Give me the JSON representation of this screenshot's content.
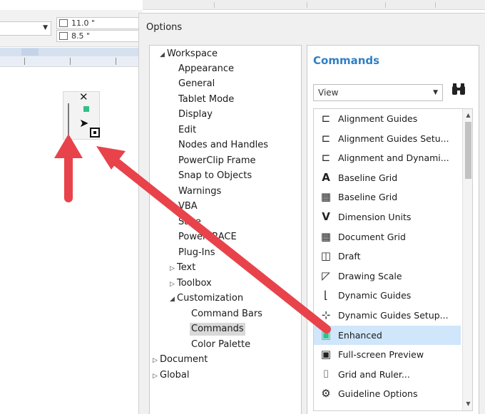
{
  "propbar": {
    "width_value": "11.0 \"",
    "height_value": "8.5 \""
  },
  "dialog": {
    "title": "Options"
  },
  "tree": {
    "items": [
      {
        "label": "Workspace",
        "expander": "◢"
      },
      {
        "label": "Appearance"
      },
      {
        "label": "General"
      },
      {
        "label": "Tablet Mode"
      },
      {
        "label": "Display"
      },
      {
        "label": "Edit"
      },
      {
        "label": "Nodes and Handles"
      },
      {
        "label": "PowerClip Frame"
      },
      {
        "label": "Snap to Objects"
      },
      {
        "label": "Warnings"
      },
      {
        "label": "VBA"
      },
      {
        "label": "Save"
      },
      {
        "label": "PowerTRACE"
      },
      {
        "label": "Plug-Ins"
      },
      {
        "label": "Text",
        "expander": "▷"
      },
      {
        "label": "Toolbox",
        "expander": "▷"
      },
      {
        "label": "Customization",
        "expander": "◢"
      },
      {
        "label": "Command Bars"
      },
      {
        "label": "Commands"
      },
      {
        "label": "Color Palette"
      },
      {
        "label": "Document",
        "expander": "▷"
      },
      {
        "label": "Global",
        "expander": "▷"
      }
    ]
  },
  "panel": {
    "title": "Commands",
    "category_select": "View"
  },
  "commands": [
    {
      "label": "Alignment Guides",
      "icon": "alignment-guides-icon",
      "glyph": "⊏"
    },
    {
      "label": "Alignment Guides Setu...",
      "icon": "alignment-guides-setup-icon",
      "glyph": "⊏"
    },
    {
      "label": "Alignment and Dynami...",
      "icon": "alignment-dynamic-icon",
      "glyph": "⊏"
    },
    {
      "label": "Baseline Grid",
      "icon": "baseline-grid-a-icon",
      "glyph": "A"
    },
    {
      "label": "Baseline Grid",
      "icon": "baseline-grid-icon",
      "glyph": "▦"
    },
    {
      "label": "Dimension Units",
      "icon": "dimension-units-icon",
      "glyph": "V"
    },
    {
      "label": "Document Grid",
      "icon": "document-grid-icon",
      "glyph": "▦"
    },
    {
      "label": "Draft",
      "icon": "draft-icon",
      "glyph": "◫"
    },
    {
      "label": "Drawing Scale",
      "icon": "drawing-scale-icon",
      "glyph": "◸"
    },
    {
      "label": "Dynamic Guides",
      "icon": "dynamic-guides-icon",
      "glyph": "⌊"
    },
    {
      "label": "Dynamic Guides Setup...",
      "icon": "dynamic-guides-setup-icon",
      "glyph": "⊹"
    },
    {
      "label": "Enhanced",
      "icon": "enhanced-icon",
      "glyph": "▣"
    },
    {
      "label": "Full-screen Preview",
      "icon": "fullscreen-preview-icon",
      "glyph": "▣"
    },
    {
      "label": "Grid and Ruler...",
      "icon": "grid-ruler-icon",
      "glyph": "⌷"
    },
    {
      "label": "Guideline Options",
      "icon": "gear-icon",
      "glyph": "⚙"
    }
  ],
  "colors": {
    "accent_title": "#2f7fc4",
    "selected_row": "#cfe6fb",
    "annotation_arrow": "#e8434a"
  }
}
